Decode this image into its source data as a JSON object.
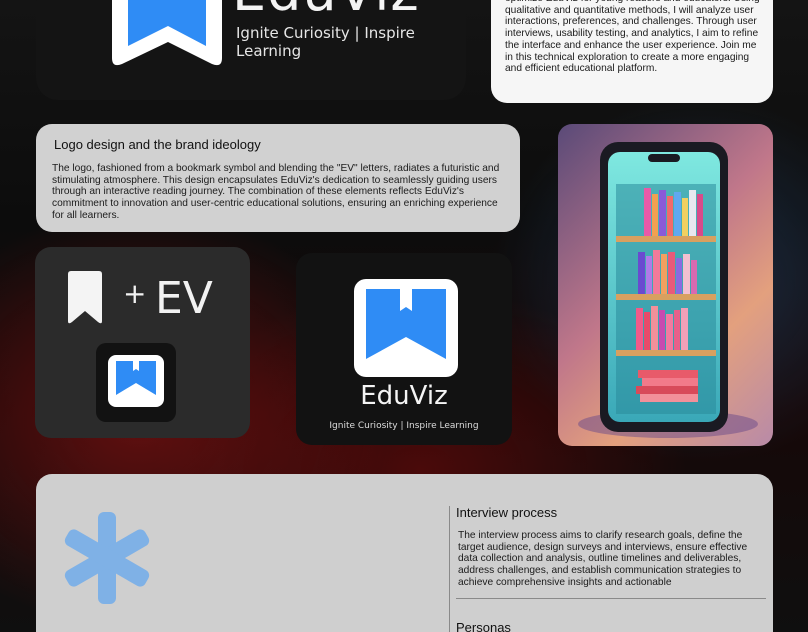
{
  "hero": {
    "wordmark": "EduViz",
    "tagline": "Ignite Curiosity | Inspire Learning"
  },
  "research": {
    "text": "optimize EduViz for young readers and educators. Using qualitative and quantitative methods, I will analyze user interactions, preferences, and challenges. Through user interviews, usability testing, and analytics, I aim to refine the interface and enhance the user experience. Join me in this technical exploration to create a more engaging and efficient educational platform."
  },
  "ideology": {
    "title": "Logo design and the brand ideology",
    "text": "The logo, fashioned from a bookmark symbol and blending the \"EV\" letters, radiates a futuristic and stimulating atmosphere. This design encapsulates EduViz's dedication to seamlessly guiding users through an interactive reading journey. The combination of these elements reflects EduViz's commitment to innovation and user-centric educational solutions, ensuring an enriching experience for all learners."
  },
  "equation": {
    "plus": "+",
    "letters": "EV",
    "icon": "bookmark-icon"
  },
  "biglogo": {
    "wordmark": "EduViz",
    "tagline": "Ignite Curiosity | Inspire Learning"
  },
  "illustration": {
    "icon": "phone-bookshelf-illustration"
  },
  "interview": {
    "title": "Interview process",
    "text": "The interview process aims to clarify research goals, define the target audience, design surveys and interviews, ensure effective data collection and analysis, outline timelines and deliverables, address challenges, and establish communication strategies to achieve comprehensive insights and actionable"
  },
  "personas": {
    "title": "Personas"
  },
  "colors": {
    "brand_blue": "#2f8cf5",
    "accent_asterisk": "#7fb1e6",
    "card_light": "#d1d1d1",
    "card_dark": "#141414"
  }
}
